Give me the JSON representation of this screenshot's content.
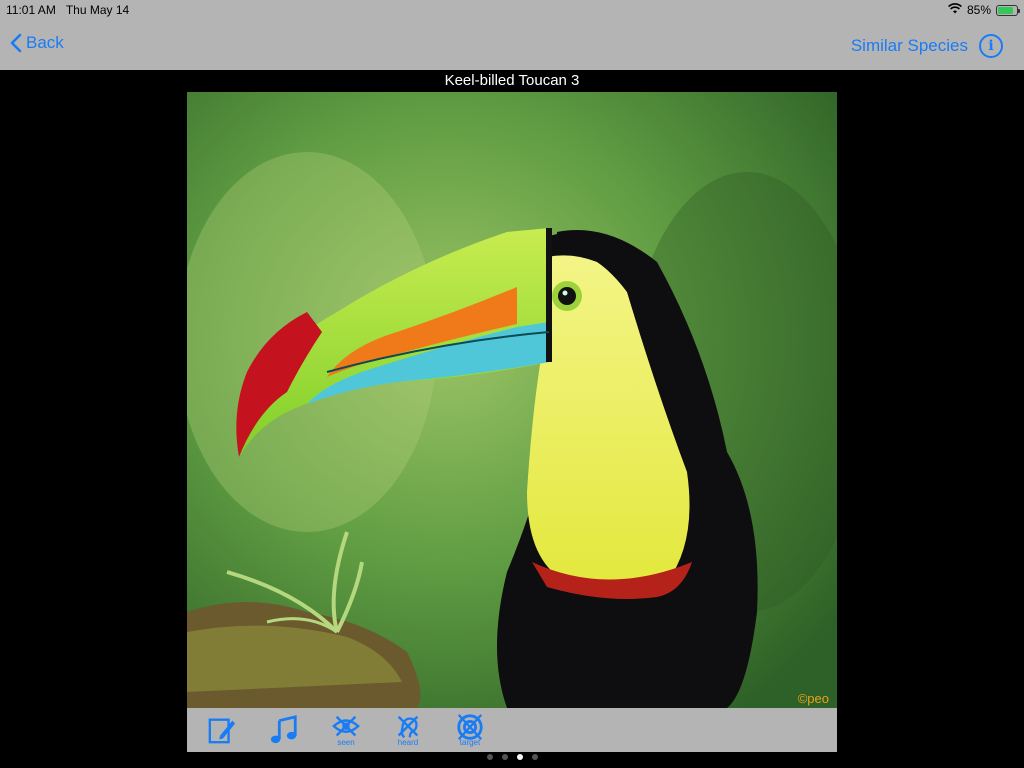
{
  "status_bar": {
    "time": "11:01 AM",
    "date": "Thu May 14",
    "battery_percent": "85%",
    "battery_level": 0.85,
    "icons": [
      "wifi-icon",
      "battery-charging-icon"
    ]
  },
  "nav": {
    "back_label": "Back",
    "similar_label": "Similar Species",
    "info_icon": "info-icon"
  },
  "photo": {
    "title": "Keel-billed Toucan 3",
    "copyright": "©peo"
  },
  "toolbar": {
    "items": [
      {
        "icon": "notes-edit-icon",
        "caption": ""
      },
      {
        "icon": "music-note-icon",
        "caption": ""
      },
      {
        "icon": "seen-icon",
        "caption": "seen"
      },
      {
        "icon": "heard-icon",
        "caption": "heard"
      },
      {
        "icon": "target-icon",
        "caption": "target"
      }
    ]
  },
  "pager": {
    "count": 4,
    "active_index": 2
  },
  "colors": {
    "accent": "#1a7cf5",
    "bar": "#b4b4b4",
    "copyright": "#e8a21a"
  }
}
